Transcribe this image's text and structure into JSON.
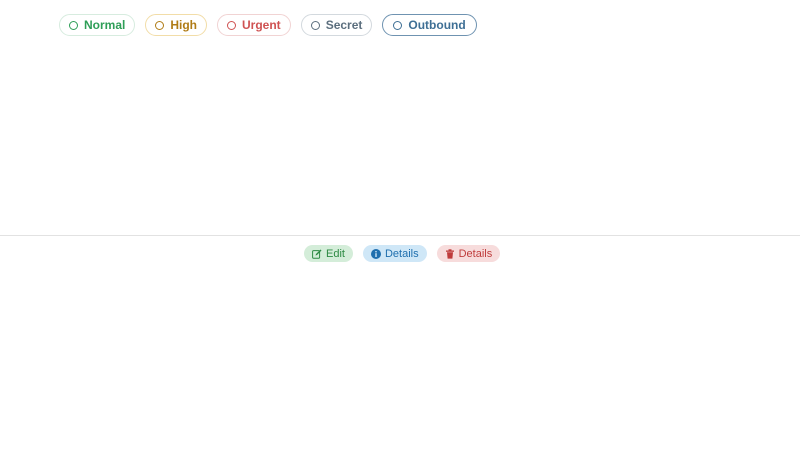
{
  "tags": [
    {
      "label": "Normal",
      "icon": "circle-outline-icon",
      "color": "#2e9e57"
    },
    {
      "label": "High",
      "icon": "circle-outline-icon",
      "color": "#b07c16"
    },
    {
      "label": "Urgent",
      "icon": "circle-outline-icon",
      "color": "#cf5252"
    },
    {
      "label": "Secret",
      "icon": "circle-outline-icon",
      "color": "#5c6f7e"
    },
    {
      "label": "Outbound",
      "icon": "circle-outline-icon",
      "color": "#3e6f95"
    }
  ],
  "actions": [
    {
      "label": "Edit",
      "icon": "edit-icon",
      "color": "#2d8a43"
    },
    {
      "label": "Details",
      "icon": "info-icon",
      "color": "#1f6fae"
    },
    {
      "label": "Details",
      "icon": "trash-icon",
      "color": "#bf3c3c"
    }
  ]
}
